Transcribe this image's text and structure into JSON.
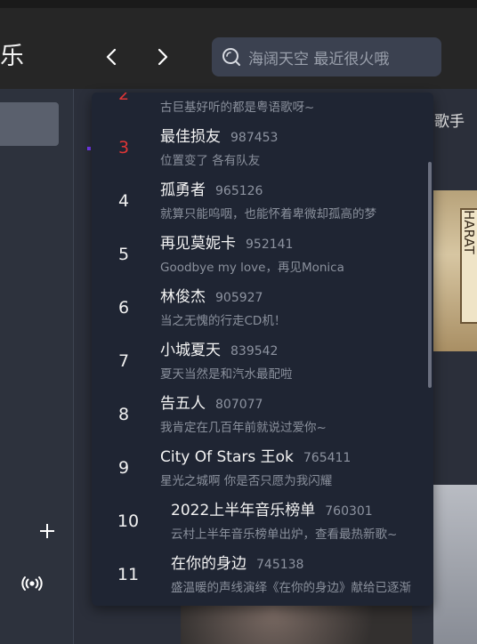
{
  "header": {
    "app_title_partial": "乐",
    "search_placeholder": "海阔天空 最近很火哦"
  },
  "main": {
    "partial_text": "歌手",
    "album_art_partial": "HARAT"
  },
  "suggestions": [
    {
      "rank": "2",
      "title": "",
      "count": "",
      "desc": "古巨基好听的都是粤语歌呀~",
      "rank_color": "#e03636"
    },
    {
      "rank": "3",
      "title": "最佳损友",
      "count": "987453",
      "desc": "位置变了 各有队友",
      "rank_color": "#e03636"
    },
    {
      "rank": "4",
      "title": "孤勇者",
      "count": "965126",
      "desc": "就算只能呜咽，也能怀着卑微却孤高的梦"
    },
    {
      "rank": "5",
      "title": "再见莫妮卡",
      "count": "952141",
      "desc": "Goodbye my love，再见Monica"
    },
    {
      "rank": "6",
      "title": "林俊杰",
      "count": "905927",
      "desc": "当之无愧的行走CD机！"
    },
    {
      "rank": "7",
      "title": "小城夏天",
      "count": "839542",
      "desc": "夏天当然是和汽水最配啦"
    },
    {
      "rank": "8",
      "title": "告五人",
      "count": "807077",
      "desc": "我肯定在几百年前就说过爱你~"
    },
    {
      "rank": "9",
      "title": "City Of Stars 王ok",
      "count": "765411",
      "desc": "星光之城啊 你是否只愿为我闪耀"
    },
    {
      "rank": "10",
      "title": "2022上半年音乐榜单",
      "count": "760301",
      "desc": "云村上半年音乐榜单出炉，查看最热新歌~"
    },
    {
      "rank": "11",
      "title": "在你的身边",
      "count": "745138",
      "desc": "盛温暖的声线演绎《在你的身边》献给已逐渐"
    }
  ],
  "colors": {
    "accent_red": "#e03636",
    "dropdown_bg": "#1f2533"
  }
}
